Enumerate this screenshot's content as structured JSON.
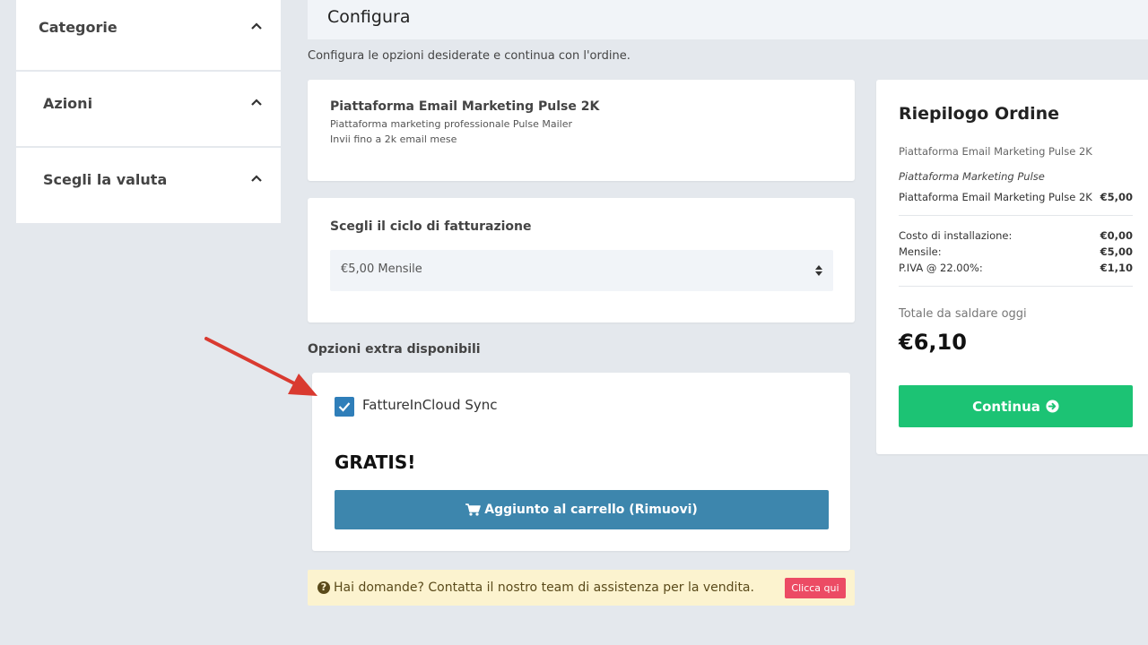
{
  "sidebar": {
    "panels": [
      {
        "title": "Categorie"
      },
      {
        "title": "Azioni"
      },
      {
        "title": "Scegli la valuta"
      }
    ]
  },
  "header": {
    "title": "Configura"
  },
  "subtitle": "Configura le opzioni desiderate e continua con l'ordine.",
  "product": {
    "name": "Piattaforma Email Marketing Pulse 2K",
    "desc_line1": "Piattaforma marketing professionale Pulse Mailer",
    "desc_line2": "Invii fino a 2k email mese"
  },
  "billing": {
    "label": "Scegli il ciclo di fatturazione",
    "selected": "€5,00 Mensile"
  },
  "extras": {
    "title": "Opzioni extra disponibili",
    "addon_name": "FattureInCloud Sync",
    "addon_checked": true,
    "price_label": "GRATIS!",
    "button_label": "Aggiunto al carrello (Rimuovi)"
  },
  "help": {
    "text": "Hai domande? Contatta il nostro team di assistenza per la vendita.",
    "button_label": "Clicca qui"
  },
  "summary": {
    "title": "Riepilogo Ordine",
    "product_name": "Piattaforma Email Marketing Pulse 2K",
    "group_name": "Piattaforma Marketing Pulse",
    "item": {
      "label": "Piattaforma Email Marketing Pulse 2K",
      "value": "€5,00"
    },
    "setup": {
      "label": "Costo di installazione:",
      "value": "€0,00"
    },
    "monthly": {
      "label": "Mensile:",
      "value": "€5,00"
    },
    "tax": {
      "label": "P.IVA @ 22.00%:",
      "value": "€1,10"
    },
    "total_label": "Totale da saldare oggi",
    "total_value": "€6,10",
    "continue_label": "Continua"
  },
  "colors": {
    "continue_button": "#1cc374",
    "cart_button": "#3d86ad",
    "checkbox": "#2f7eb9",
    "help_bg": "#fcf3cf",
    "help_button": "#ec4b64",
    "annotation_arrow": "#d93a30"
  },
  "icons": {
    "sidebar_chevron": "chevron-up-icon",
    "select": "sort-icon",
    "checkbox": "check-icon",
    "cart": "cart-icon",
    "help": "question-circle-icon",
    "continue": "arrow-circle-right-icon"
  }
}
